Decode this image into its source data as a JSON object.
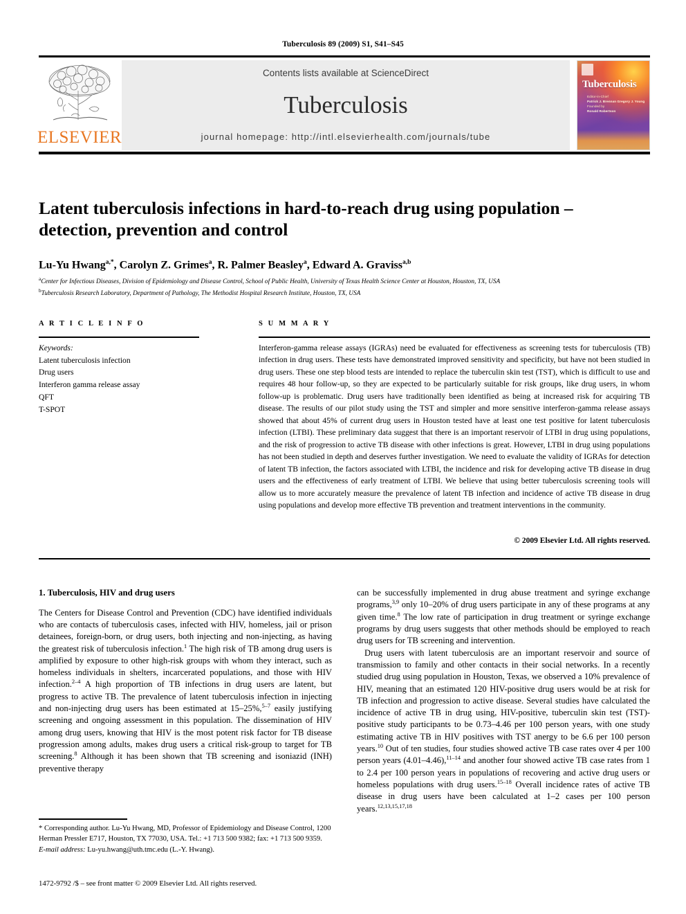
{
  "running_head": "Tuberculosis 89 (2009) S1, S41–S45",
  "masthead": {
    "publisher_name": "ELSEVIER",
    "contents_line": "Contents lists available at ScienceDirect",
    "journal_name": "Tuberculosis",
    "homepage_line": "journal homepage: http://intl.elsevierhealth.com/journals/tube",
    "cover": {
      "title": "Tuberculosis",
      "editor_label": "Editor-in-Chief",
      "editor_names": "Patrick J. Brennan\nGregory J. Young",
      "founding_label": "Founded by",
      "founding_name": "Ronald Robertson"
    }
  },
  "article": {
    "title": "Latent tuberculosis infections in hard-to-reach drug using population – detection, prevention and control",
    "authors_html": "Lu-Yu Hwang<sup>a,</sup><sup>*</sup>, Carolyn Z. Grimes<sup>a</sup>, R. Palmer Beasley<sup>a</sup>, Edward A. Graviss<sup>a,b</sup>",
    "affiliations": [
      "Center for Infectious Diseases, Division of Epidemiology and Disease Control, School of Public Health, University of Texas Health Science Center at Houston, Houston, TX, USA",
      "Tuberculosis Research Laboratory, Department of Pathology, The Methodist Hospital Research Institute, Houston, TX, USA"
    ],
    "affiliation_marks": [
      "a",
      "b"
    ]
  },
  "info_section": {
    "heading": "A R T I C L E   I N F O",
    "keywords_label": "Keywords:",
    "keywords": [
      "Latent tuberculosis infection",
      "Drug users",
      "Interferon gamma release assay",
      "QFT",
      "T-SPOT"
    ]
  },
  "summary_section": {
    "heading": "S U M M A R Y",
    "abstract": "Interferon-gamma release assays (IGRAs) need be evaluated for effectiveness as screening tests for tuberculosis (TB) infection in drug users. These tests have demonstrated improved sensitivity and specificity, but have not been studied in drug users. These one step blood tests are intended to replace the tuberculin skin test (TST), which is difficult to use and requires 48 hour follow-up, so they are expected to be particularly suitable for risk groups, like drug users, in whom follow-up is problematic. Drug users have traditionally been identified as being at increased risk for acquiring TB disease. The results of our pilot study using the TST and simpler and more sensitive interferon-gamma release assays showed that about 45% of current drug users in Houston tested have at least one test positive for latent tuberculosis infection (LTBI). These preliminary data suggest that there is an important reservoir of LTBI in drug using populations, and the risk of progression to active TB disease with other infections is great. However, LTBI in drug using populations has not been studied in depth and deserves further investigation. We need to evaluate the validity of IGRAs for detection of latent TB infection, the factors associated with LTBI, the incidence and risk for developing active TB disease in drug users and the effectiveness of early treatment of LTBI. We believe that using better tuberculosis screening tools will allow us to more accurately measure the prevalence of latent TB infection and incidence of active TB disease in drug using populations and develop more effective TB prevention and treatment interventions in the community.",
    "copyright": "© 2009 Elsevier Ltd. All rights reserved."
  },
  "body": {
    "section_heading": "1. Tuberculosis, HIV and drug users",
    "left_paragraph_html": "The Centers for Disease Control and Prevention (CDC) have identified individuals who are contacts of tuberculosis cases, infected with HIV, homeless, jail or prison detainees, foreign-born, or drug users, both injecting and non-injecting, as having the greatest risk of tuberculosis infection.<sup>1</sup> The high risk of TB among drug users is amplified by exposure to other high-risk groups with whom they interact, such as homeless individuals in shelters, incarcerated populations, and those with HIV infection.<sup>2–4</sup> A high proportion of TB infections in drug users are latent, but progress to active TB. The prevalence of latent tuberculosis infection in injecting and non-injecting drug users has been estimated at 15–25%,<sup>5–7</sup> easily justifying screening and ongoing assessment in this population. The dissemination of HIV among drug users, knowing that HIV is the most potent risk factor for TB disease progression among adults, makes drug users a critical risk-group to target for TB screening.<sup>8</sup> Although it has been shown that TB screening and isoniazid (INH) preventive therapy",
    "right_paragraph_1_html": "can be successfully implemented in drug abuse treatment and syringe exchange programs,<sup>3,9</sup> only 10–20% of drug users participate in any of these programs at any given time.<sup>8</sup> The low rate of participation in drug treatment or syringe exchange programs by drug users suggests that other methods should be employed to reach drug users for TB screening and intervention.",
    "right_paragraph_2_html": "Drug users with latent tuberculosis are an important reservoir and source of transmission to family and other contacts in their social networks. In a recently studied drug using population in Houston, Texas, we observed a 10% prevalence of HIV, meaning that an estimated 120 HIV-positive drug users would be at risk for TB infection and progression to active disease. Several studies have calculated the incidence of active TB in drug using, HIV-positive, tuberculin skin test (TST)-positive study participants to be 0.73–4.46 per 100 person years, with one study estimating active TB in HIV positives with TST anergy to be 6.6 per 100 person years.<sup>10</sup> Out of ten studies, four studies showed active TB case rates over 4 per 100 person years (4.01–4.46),<sup>11–14</sup> and another four showed active TB case rates from 1 to 2.4 per 100 person years in populations of recovering and active drug users or homeless populations with drug users.<sup>15–18</sup> Overall incidence rates of active TB disease in drug users have been calculated at 1–2 cases per 100 person years.<sup>12,13,15,17,18</sup>"
  },
  "footnotes": {
    "corresponding_html": "* Corresponding author. Lu-Yu Hwang, MD, Professor of Epidemiology and Disease Control, 1200 Herman Pressler E717, Houston, TX 77030, USA. Tel.: +1 713 500 9382; fax: +1 713 500 9359.",
    "email_label": "E-mail address:",
    "email_value": "Lu-yu.hwang@uth.tmc.edu (L.-Y. Hwang).",
    "issn_line": "1472-9792 /$ – see front matter © 2009 Elsevier Ltd. All rights reserved."
  },
  "colors": {
    "elsevier_orange": "#E87722",
    "band_gray": "#ECECEC",
    "text_black": "#000000"
  }
}
